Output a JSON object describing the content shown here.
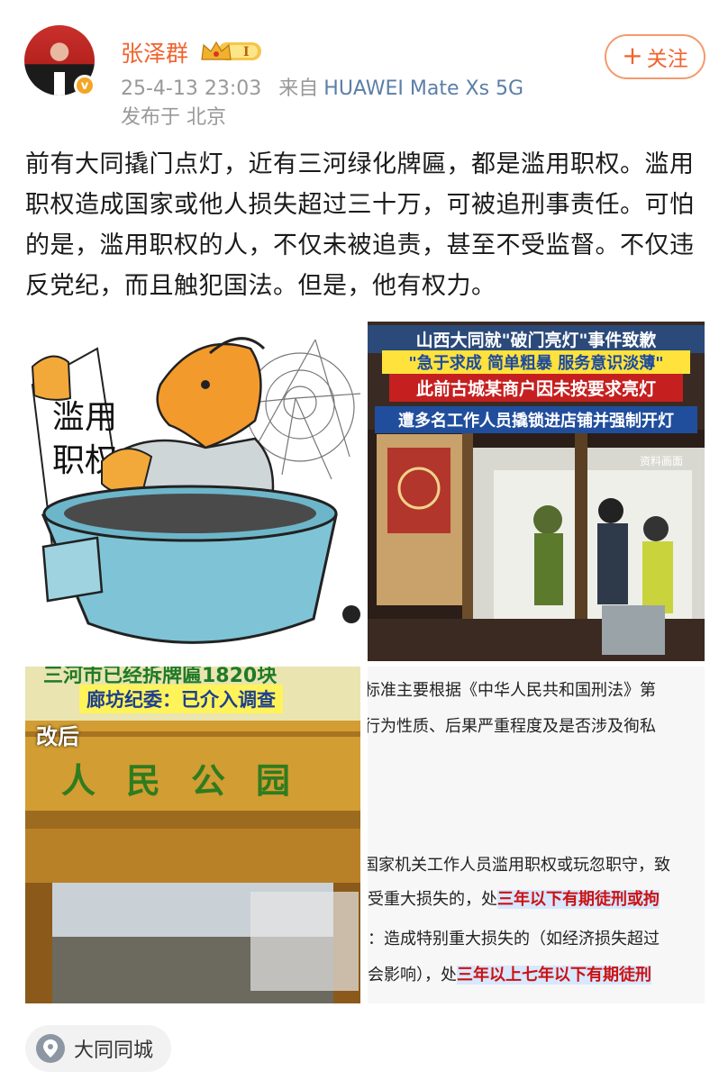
{
  "author": {
    "name": "张泽群",
    "level_badge": "I",
    "verified_mark": "v"
  },
  "post_meta": {
    "timestamp": "25-4-13 23:03",
    "source_prefix": "来自",
    "device": "HUAWEI Mate Xs 5G",
    "location": "发布于 北京"
  },
  "follow_button": {
    "plus": "+",
    "label": "关注"
  },
  "post_text": "前有大同撬门点灯，近有三河绿化牌匾，都是滥用职权。滥用职权造成国家或他人损失超过三十万，可被追刑事责任。可怕的是，滥用职权的人，不仅未被追责，甚至不受监督。不仅违反党纪，而且触犯国法。但是，他有权力。",
  "images": {
    "cartoon": {
      "sign_text": "滥用\n职权"
    },
    "news_still": {
      "line1": "山西大同就\"破门亮灯\"事件致歉",
      "line2": "\"急于求成 简单粗暴 服务意识淡薄\"",
      "line3": "此前古城某商户因未按要求亮灯",
      "line4": "遭多名工作人员撬锁进店铺并强制开灯",
      "watermark": "资料画面"
    },
    "park_gate": {
      "headline_cut": "三河市已经拆牌匾1820块",
      "subheadline": "廊坊纪委：已介入调查",
      "tag": "改后",
      "gate_sign": "人民公园"
    },
    "law_excerpt": {
      "line1": "标准主要根据《中华人民共和国刑法》第",
      "line2": "行为性质、后果严重程度及是否涉及徇私",
      "line3": "国家机关工作人员滥用职权或玩忽职守，致",
      "line4a": "受重大损失的，处",
      "line4b": "三年以下有期徒刑或拘",
      "line5": "：造成特别重大损失的（如经济损失超过",
      "line6a": "会影响），处",
      "line6b": "三年以上七年以下有期徒刑"
    }
  },
  "topic": {
    "icon": "location-pin-icon",
    "label": "大同同城"
  }
}
